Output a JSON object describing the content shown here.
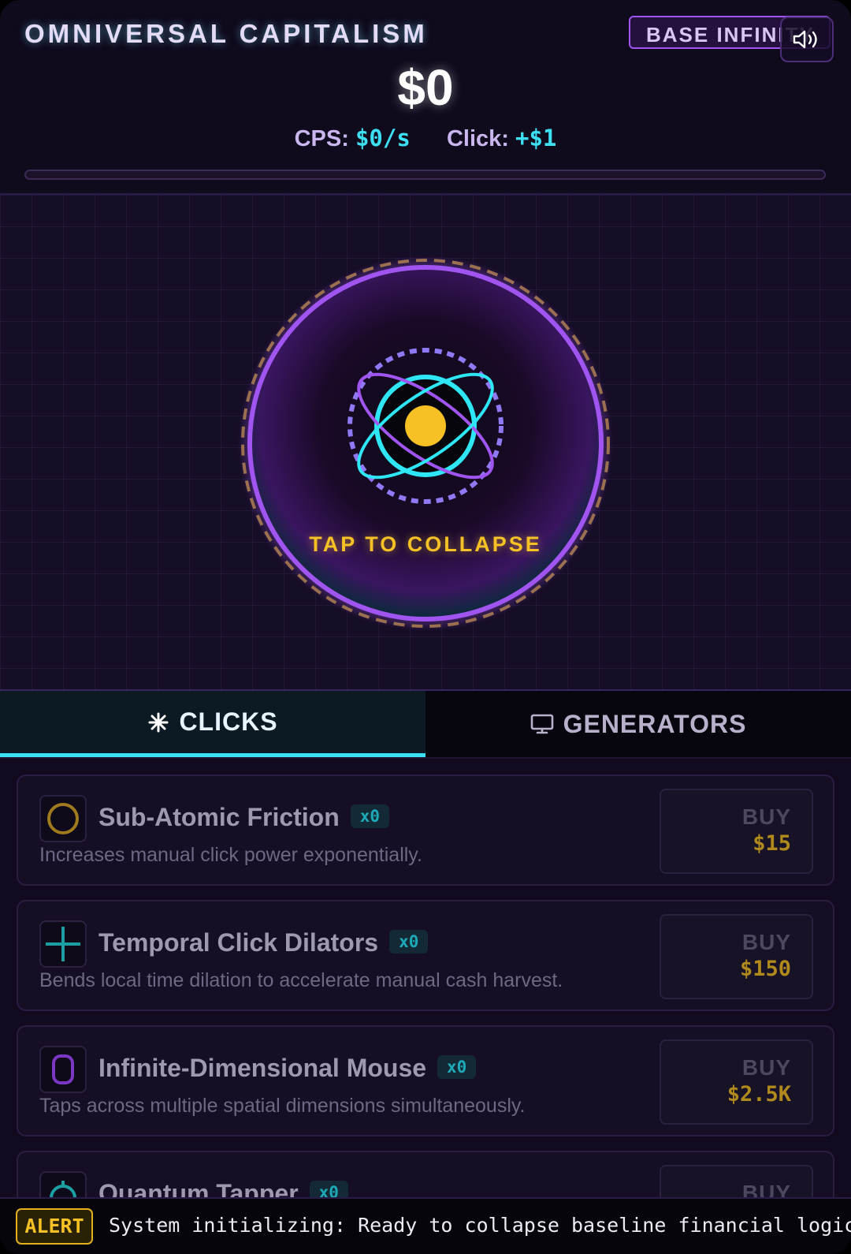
{
  "header": {
    "title": "OMNIVERSAL CAPITALISM",
    "tier_badge": "BASE INFINITY",
    "sound_icon": "speaker-icon",
    "money": "$0",
    "cps_label": "CPS:",
    "cps_value": "$0/s",
    "click_label": "Click:",
    "click_value": "+$1",
    "progress": 0
  },
  "core": {
    "label": "TAP TO COLLAPSE",
    "icon": "atom-icon"
  },
  "tabs": [
    {
      "label": "CLICKS",
      "icon": "sparkle-icon",
      "active": true
    },
    {
      "label": "GENERATORS",
      "icon": "monitor-icon",
      "active": false
    }
  ],
  "upgrades": [
    {
      "name": "Sub-Atomic Friction",
      "count": "x0",
      "desc": "Increases manual click power exponentially.",
      "buy": "BUY",
      "price": "$15",
      "icon": "circle-icon"
    },
    {
      "name": "Temporal Click Dilators",
      "count": "x0",
      "desc": "Bends local time dilation to accelerate manual cash harvest.",
      "buy": "BUY",
      "price": "$150",
      "icon": "crosshair-icon"
    },
    {
      "name": "Infinite-Dimensional Mouse",
      "count": "x0",
      "desc": "Taps across multiple spatial dimensions simultaneously.",
      "buy": "BUY",
      "price": "$2.5K",
      "icon": "mouse-icon"
    },
    {
      "name": "Quantum Tapper",
      "count": "x0",
      "desc": "",
      "buy": "BUY",
      "price": "",
      "icon": "stopwatch-icon"
    }
  ],
  "alert": {
    "tag": "ALERT",
    "message": "System initializing: Ready to collapse baseline financial logic..."
  },
  "colors": {
    "accent_cyan": "#3de0f2",
    "accent_purple": "#a055f0",
    "accent_gold": "#f5c125",
    "background": "#0d0818"
  }
}
